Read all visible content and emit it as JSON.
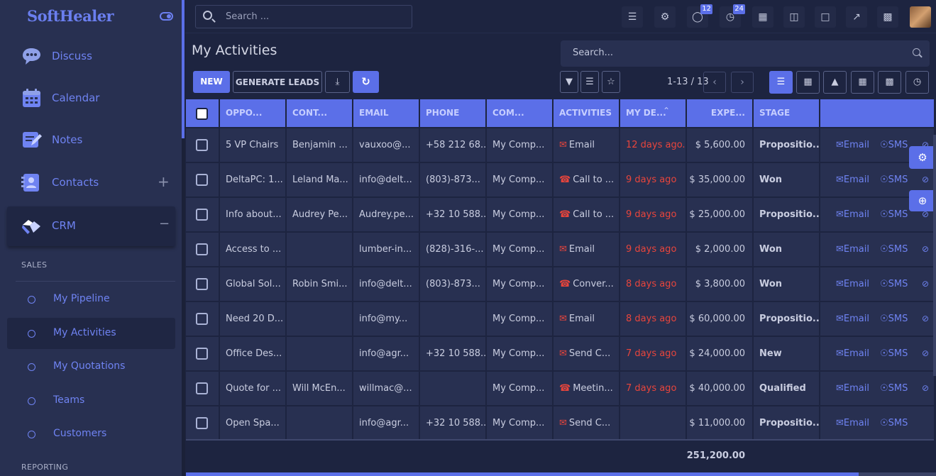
{
  "sidebar": {
    "logo": "SoftHealer",
    "apps": [
      {
        "label": "Discuss",
        "icon": "discuss-icon"
      },
      {
        "label": "Calendar",
        "icon": "calendar-icon"
      },
      {
        "label": "Notes",
        "icon": "notes-icon"
      },
      {
        "label": "Contacts",
        "icon": "contacts-icon",
        "toggle": "+"
      },
      {
        "label": "CRM",
        "icon": "crm-icon",
        "toggle": "−"
      }
    ],
    "sales_title": "SALES",
    "sales_items": [
      "My Pipeline",
      "My Activities",
      "My Quotations",
      "Teams",
      "Customers"
    ],
    "reporting_title": "REPORTING"
  },
  "topbar": {
    "search_placeholder": "Search ...",
    "chat_badge": "12",
    "activity_badge": "24"
  },
  "page": {
    "title": "My Activities",
    "search_placeholder": "Search...",
    "new_label": "NEW",
    "generate_leads_label": "GENERATE LEADS",
    "pager": "1-13 / 13"
  },
  "table": {
    "columns": [
      "OPPO...",
      "CONT...",
      "EMAIL",
      "PHONE",
      "COM...",
      "ACTIVITIES",
      "MY DE...",
      "EXPE...",
      "STAGE"
    ],
    "rows": [
      {
        "opp": "5 VP Chairs",
        "contact": "Benjamin ...",
        "email": "vauxoo@...",
        "phone": "+58 212 68...",
        "company": "My Comp...",
        "activity_type": "email",
        "activity": "Email",
        "deadline": "12 days ago...",
        "revenue": "$ 5,600.00",
        "stage": "Propositio...",
        "email_action": "Email",
        "sms_action": "SMS"
      },
      {
        "opp": "DeltaPC: 1...",
        "contact": "Leland Ma...",
        "email": "info@delt...",
        "phone": "(803)-873...",
        "company": "My Comp...",
        "activity_type": "call",
        "activity": "Call to ...",
        "deadline": "9 days ago",
        "revenue": "$ 35,000.00",
        "stage": "Won",
        "email_action": "Email",
        "sms_action": "SMS"
      },
      {
        "opp": "Info about...",
        "contact": "Audrey Pe...",
        "email": "Audrey.pe...",
        "phone": "+32 10 588...",
        "company": "My Comp...",
        "activity_type": "call",
        "activity": "Call to ...",
        "deadline": "9 days ago",
        "revenue": "$ 25,000.00",
        "stage": "Propositio...",
        "email_action": "Email",
        "sms_action": "SMS"
      },
      {
        "opp": "Access to ...",
        "contact": "",
        "email": "lumber-in...",
        "phone": "(828)-316-...",
        "company": "My Comp...",
        "activity_type": "email",
        "activity": "Email",
        "deadline": "9 days ago",
        "revenue": "$ 2,000.00",
        "stage": "Won",
        "email_action": "Email",
        "sms_action": "SMS"
      },
      {
        "opp": "Global Sol...",
        "contact": "Robin Smi...",
        "email": "info@delt...",
        "phone": "(803)-873...",
        "company": "My Comp...",
        "activity_type": "call",
        "activity": "Conver...",
        "deadline": "8 days ago",
        "revenue": "$ 3,800.00",
        "stage": "Won",
        "email_action": "Email",
        "sms_action": "SMS"
      },
      {
        "opp": "Need 20 D...",
        "contact": "",
        "email": "info@my...",
        "phone": "",
        "company": "My Comp...",
        "activity_type": "email",
        "activity": "Email",
        "deadline": "8 days ago",
        "revenue": "$ 60,000.00",
        "stage": "Propositio...",
        "email_action": "Email",
        "sms_action": "SMS"
      },
      {
        "opp": "Office Des...",
        "contact": "",
        "email": "info@agr...",
        "phone": "+32 10 588...",
        "company": "My Comp...",
        "activity_type": "email",
        "activity": "Send C...",
        "deadline": "7 days ago",
        "revenue": "$ 24,000.00",
        "stage": "New",
        "email_action": "Email",
        "sms_action": "SMS"
      },
      {
        "opp": "Quote for ...",
        "contact": "Will McEn...",
        "email": "willmac@...",
        "phone": "",
        "company": "My Comp...",
        "activity_type": "call",
        "activity": "Meetin...",
        "deadline": "7 days ago",
        "revenue": "$ 40,000.00",
        "stage": "Qualified",
        "email_action": "Email",
        "sms_action": "SMS"
      },
      {
        "opp": "Open Spa...",
        "contact": "",
        "email": "info@agr...",
        "phone": "+32 10 588...",
        "company": "My Comp...",
        "activity_type": "email",
        "activity": "Send C...",
        "deadline": "",
        "revenue": "$ 11,000.00",
        "stage": "Propositio...",
        "email_action": "Email",
        "sms_action": "SMS"
      }
    ],
    "total": "251,200.00"
  },
  "colors": {
    "accent": "#5b6fe8",
    "sidebar_bg": "#283051",
    "main_bg": "#1d2440",
    "link": "#6f83f2",
    "overdue": "#e8453c"
  }
}
